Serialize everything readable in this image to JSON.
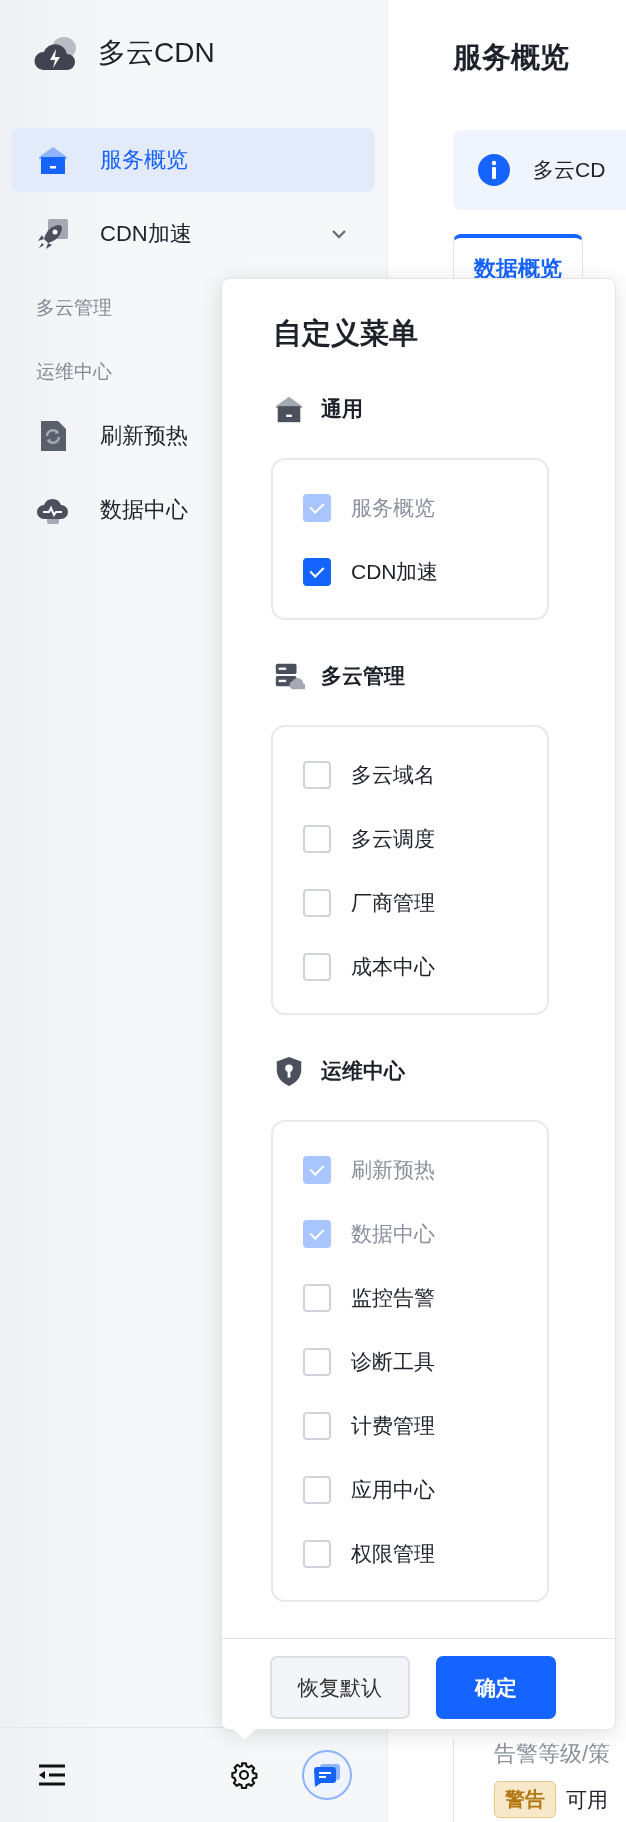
{
  "app": {
    "name": "多云CDN"
  },
  "sidebar": {
    "items": [
      {
        "kind": "link",
        "label": "服务概览",
        "selected": true
      },
      {
        "kind": "submenu",
        "label": "CDN加速",
        "selected": false
      },
      {
        "kind": "group",
        "label": "多云管理"
      },
      {
        "kind": "group",
        "label": "运维中心"
      },
      {
        "kind": "link",
        "label": "刷新预热",
        "selected": false
      },
      {
        "kind": "link",
        "label": "数据中心",
        "selected": false
      }
    ]
  },
  "page": {
    "title": "服务概览",
    "notice": "多云CD",
    "tabs": [
      {
        "label": "数据概览",
        "selected": true
      }
    ],
    "alert_heading": "告警等级/策",
    "alerts": [
      {
        "level_label": "警告",
        "text": "可用"
      }
    ]
  },
  "customize_menu": {
    "title": "自定义菜单",
    "sections": [
      {
        "title": "通用",
        "items": [
          {
            "label": "服务概览",
            "checked": true,
            "disabled": true
          },
          {
            "label": "CDN加速",
            "checked": true,
            "disabled": false
          }
        ]
      },
      {
        "title": "多云管理",
        "items": [
          {
            "label": "多云域名",
            "checked": false,
            "disabled": false
          },
          {
            "label": "多云调度",
            "checked": false,
            "disabled": false
          },
          {
            "label": "厂商管理",
            "checked": false,
            "disabled": false
          },
          {
            "label": "成本中心",
            "checked": false,
            "disabled": false
          }
        ]
      },
      {
        "title": "运维中心",
        "items": [
          {
            "label": "刷新预热",
            "checked": true,
            "disabled": true
          },
          {
            "label": "数据中心",
            "checked": true,
            "disabled": true
          },
          {
            "label": "监控告警",
            "checked": false,
            "disabled": false
          },
          {
            "label": "诊断工具",
            "checked": false,
            "disabled": false
          },
          {
            "label": "计费管理",
            "checked": false,
            "disabled": false
          },
          {
            "label": "应用中心",
            "checked": false,
            "disabled": false
          },
          {
            "label": "权限管理",
            "checked": false,
            "disabled": false
          }
        ]
      }
    ],
    "buttons": [
      {
        "label": "恢复默认",
        "kind": "secondary"
      },
      {
        "label": "确定",
        "kind": "primary"
      }
    ]
  }
}
